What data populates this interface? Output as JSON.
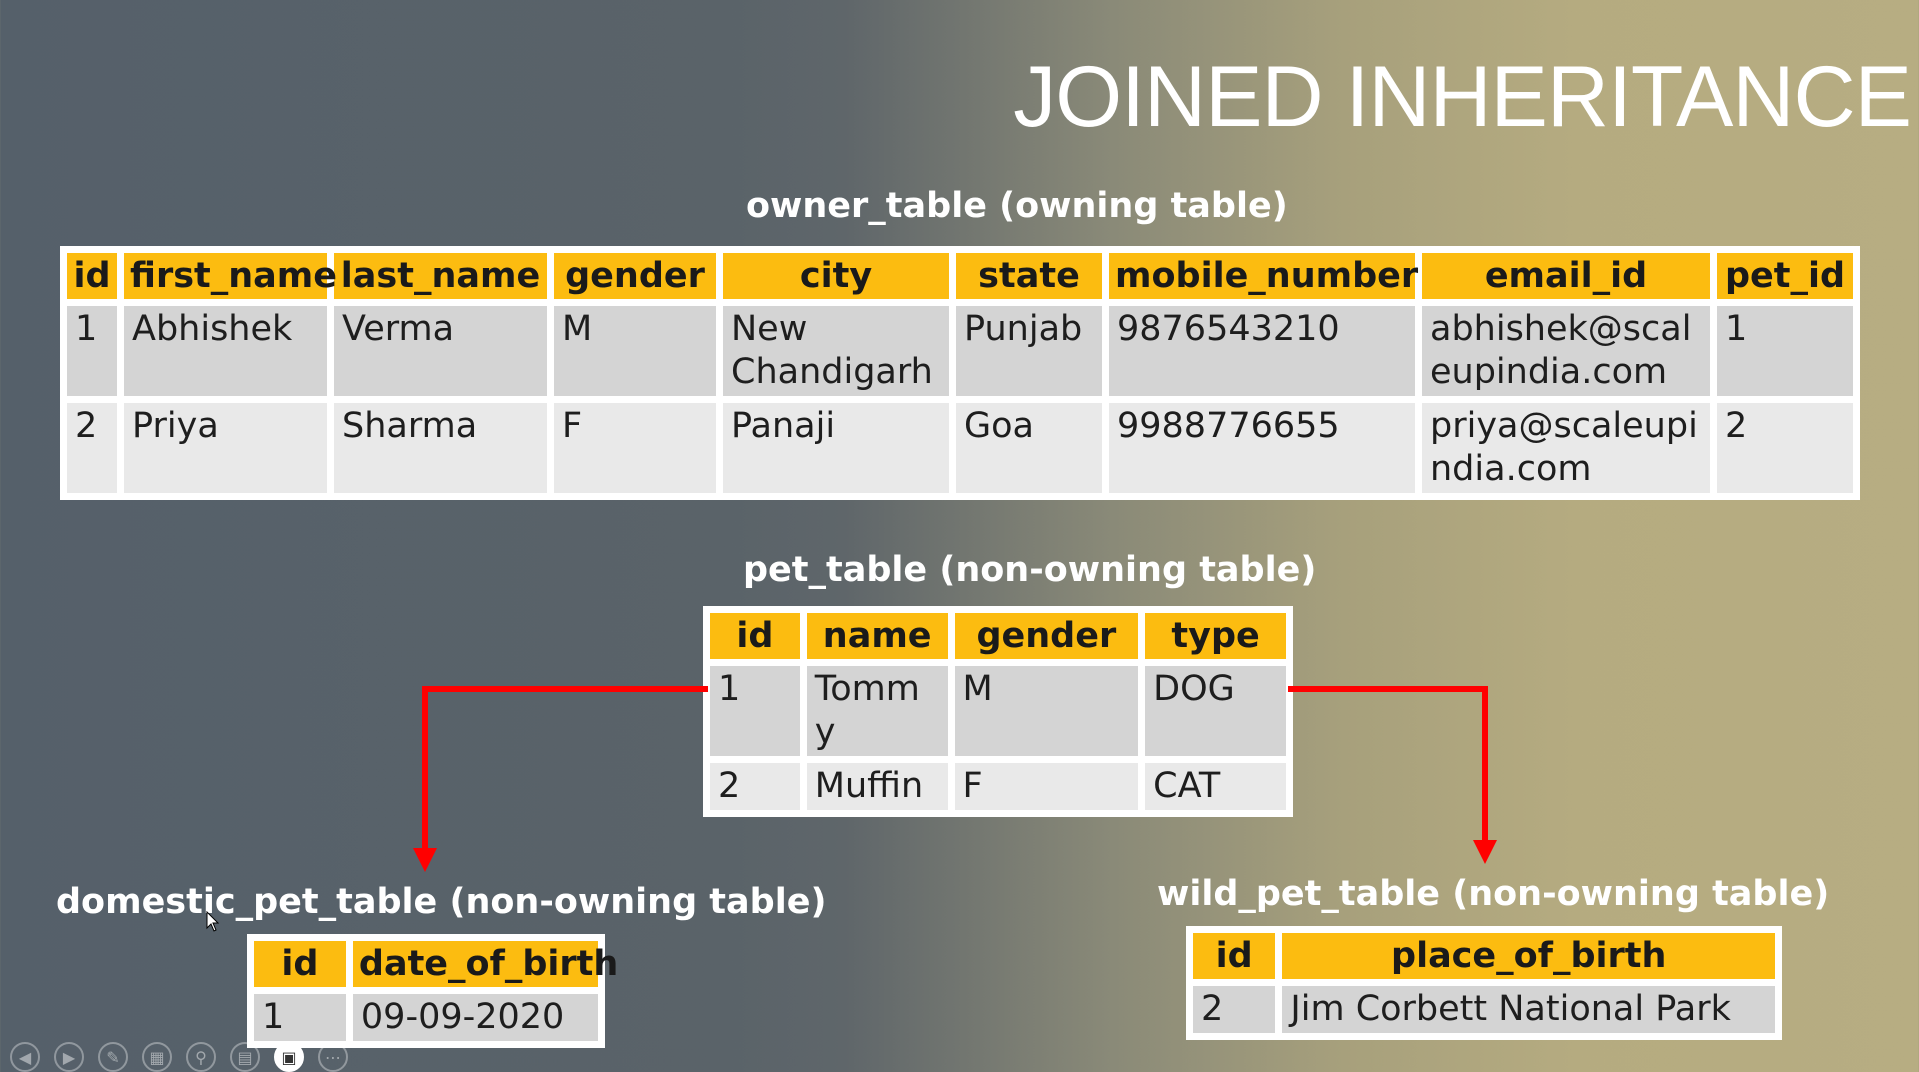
{
  "slide": {
    "title": "JOINED INHERITANCE"
  },
  "owner_table": {
    "caption": "owner_table (owning table)",
    "headers": [
      "id",
      "first_name",
      "last_name",
      "gender",
      "city",
      "state",
      "mobile_number",
      "email_id",
      "pet_id"
    ],
    "rows": [
      [
        "1",
        "Abhishek",
        "Verma",
        "M",
        "New Chandigarh",
        "Punjab",
        "9876543210",
        "abhishek@scaleupindia.com",
        "1"
      ],
      [
        "2",
        "Priya",
        "Sharma",
        "F",
        "Panaji",
        "Goa",
        "9988776655",
        "priya@scaleupindia.com",
        "2"
      ]
    ]
  },
  "pet_table": {
    "caption": "pet_table (non-owning table)",
    "headers": [
      "id",
      "name",
      "gender",
      "type"
    ],
    "rows": [
      [
        "1",
        "Tommy",
        "M",
        "DOG"
      ],
      [
        "2",
        "Muffin",
        "F",
        "CAT"
      ]
    ]
  },
  "domestic_pet_table": {
    "caption": "domestic_pet_table (non-owning table)",
    "headers": [
      "id",
      "date_of_birth"
    ],
    "rows": [
      [
        "1",
        "09-09-2020"
      ]
    ]
  },
  "wild_pet_table": {
    "caption": "wild_pet_table (non-owning table)",
    "headers": [
      "id",
      "place_of_birth"
    ],
    "rows": [
      [
        "2",
        "Jim Corbett National Park"
      ]
    ]
  },
  "colors": {
    "header": "#fcbc10",
    "arrow": "#ff0000",
    "row_odd": "#d4d4d4",
    "row_even": "#e9e9e9"
  },
  "toolbar": [
    "previous-icon",
    "next-icon",
    "pen-icon",
    "slides-icon",
    "zoom-icon",
    "subtitles-icon",
    "camera-icon",
    "more-icon"
  ]
}
